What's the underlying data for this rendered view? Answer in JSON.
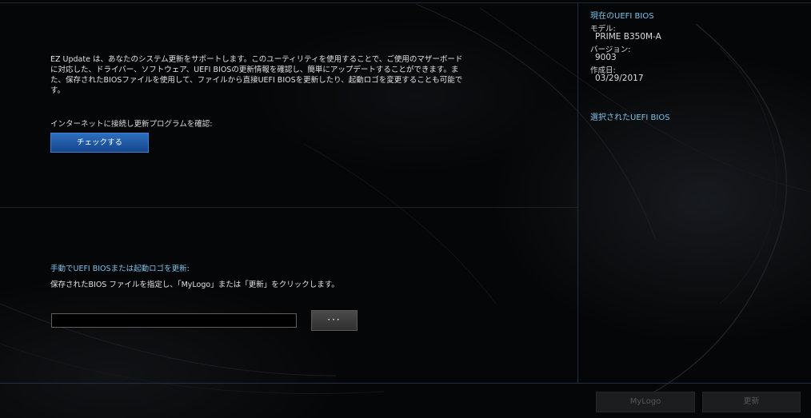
{
  "main": {
    "description": "EZ Update は、あなたのシステム更新をサポートします。このユーティリティを使用することで、ご使用のマザーボードに対応した、ドライバー、ソフトウェア、UEFI BIOSの更新情報を確認し、簡単にアップデートすることができます。また、保存されたBIOSファイルを使用して、ファイルから直接UEFI BIOSを更新したり、起動ロゴを変更することも可能です。",
    "online_label": "インターネットに接続し更新プログラムを確認:",
    "check_button": "チェックする",
    "manual_label": "手動でUEFI BIOSまたは起動ロゴを更新:",
    "manual_desc": "保存されたBIOS ファイルを指定し、「MyLogo」または「更新」をクリックします。",
    "file_path_value": "",
    "browse_button": "···"
  },
  "sidebar": {
    "current_title": "現在のUEFI BIOS",
    "model_label": "モデル:",
    "model_value": "PRIME B350M-A",
    "version_label": "バージョン:",
    "version_value": "9003",
    "date_label": "作成日:",
    "date_value": "03/29/2017",
    "selected_title": "選択されたUEFI BIOS"
  },
  "footer": {
    "mylogo_button": "MyLogo",
    "update_button": "更新"
  },
  "colors": {
    "accent_blue": "#7ec3ea",
    "button_blue": "#1f5aa8",
    "background": "#050607"
  }
}
